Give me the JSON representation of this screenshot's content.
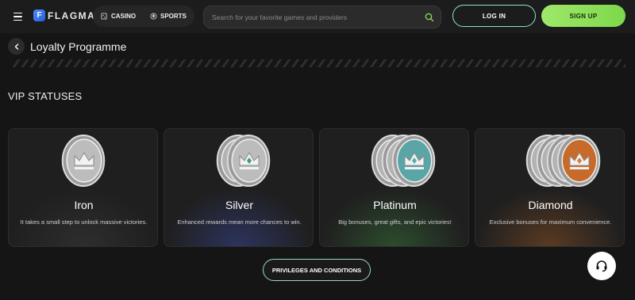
{
  "header": {
    "logo_text": "FLAGMAN",
    "logo_mark": "F",
    "nav": [
      {
        "label": "CASINO",
        "icon": "dice-icon"
      },
      {
        "label": "SPORTS",
        "icon": "ball-icon"
      }
    ],
    "search_placeholder": "Search for your favorite games and providers",
    "login_label": "LOG IN",
    "signup_label": "SIGN UP"
  },
  "page": {
    "title": "Loyalty Programme",
    "section_title": "VIP STATUSES"
  },
  "tiers": [
    {
      "name": "Iron",
      "description": "It takes a small step to unlock massive victories.",
      "coin_count": 1,
      "accent": "#c9c9c9"
    },
    {
      "name": "Silver",
      "description": "Enhanced rewards mean more chances to win.",
      "coin_count": 2,
      "accent": "#3f9c6a"
    },
    {
      "name": "Platinum",
      "description": "Big bonuses, great gifts, and epic victories!",
      "coin_count": 3,
      "accent": "#4fb0b0"
    },
    {
      "name": "Diamond",
      "description": "Exclusive bonuses for maximum convenience.",
      "coin_count": 4,
      "accent": "#e07a2a"
    }
  ],
  "privileges_label": "PRIVILEGES AND CONDITIONS",
  "colors": {
    "login_border": "#8fe3c8",
    "signup_bg": "#8ee05a",
    "background": "#151515"
  }
}
